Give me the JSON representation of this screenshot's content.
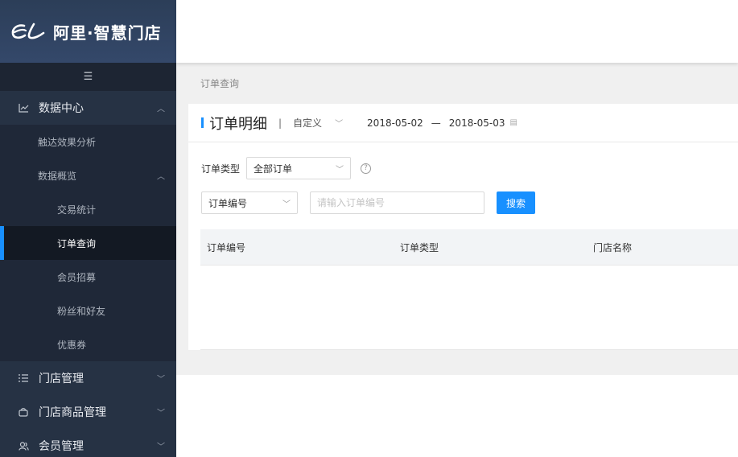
{
  "brand": {
    "name": "阿里·智慧门店"
  },
  "sidebar": {
    "collapse_icon": "menu-fold-icon",
    "data_center": {
      "label": "数据中心",
      "icon": "line-chart-icon",
      "items": [
        {
          "label": "触达效果分析"
        },
        {
          "label": "数据概览",
          "children": [
            {
              "label": "交易统计"
            },
            {
              "label": "订单查询",
              "active": true
            },
            {
              "label": "会员招募"
            },
            {
              "label": "粉丝和好友"
            },
            {
              "label": "优惠券"
            }
          ]
        }
      ]
    },
    "groups": [
      {
        "label": "门店管理",
        "icon": "list-icon"
      },
      {
        "label": "门店商品管理",
        "icon": "shopping-bag-icon"
      },
      {
        "label": "会员管理",
        "icon": "user-group-icon"
      }
    ]
  },
  "breadcrumb": "订单查询",
  "panel": {
    "title": "订单明细",
    "range_label": "自定义",
    "date_start": "2018-05-02",
    "date_sep": "—",
    "date_end": "2018-05-03"
  },
  "filters": {
    "order_type_label": "订单类型",
    "order_type_value": "全部订单",
    "search_field_value": "订单编号",
    "search_placeholder": "请输入订单编号",
    "search_button": "搜索"
  },
  "table": {
    "columns": [
      "订单编号",
      "订单类型",
      "门店名称"
    ]
  },
  "colors": {
    "accent": "#1890ff",
    "sidebar_bg": "#2a3649"
  }
}
